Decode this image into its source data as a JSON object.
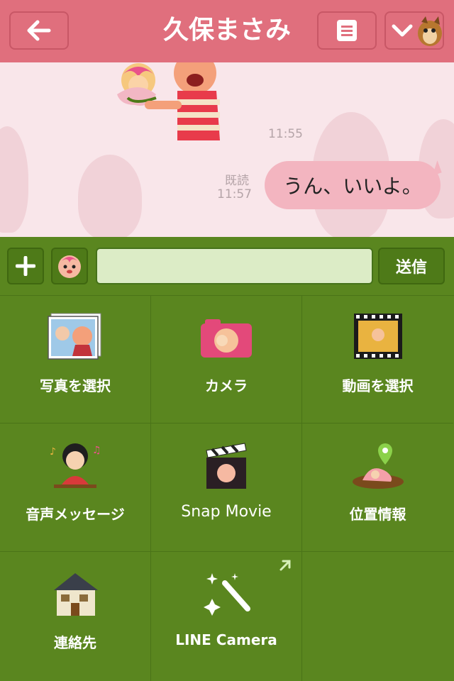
{
  "header": {
    "back_label": "←",
    "title": "久保まさみ",
    "menu_icon": "list-icon",
    "dropdown_icon": "chevron-down-icon",
    "bg_color": "#e06f7d"
  },
  "chat": {
    "sticker_time": "11:55",
    "read_label": "既読",
    "message_time": "11:57",
    "message_text": "うん、いいよ。",
    "bubble_color": "#f3b5c0"
  },
  "composer": {
    "plus_label": "+",
    "input_value": "",
    "input_placeholder": "",
    "send_label": "送信"
  },
  "attach_menu": {
    "items": [
      {
        "label": "写真を選択",
        "icon": "photo-select-icon"
      },
      {
        "label": "カメラ",
        "icon": "camera-icon"
      },
      {
        "label": "動画を選択",
        "icon": "video-select-icon"
      },
      {
        "label": "音声メッセージ",
        "icon": "voice-message-icon"
      },
      {
        "label": "Snap Movie",
        "icon": "snap-movie-icon"
      },
      {
        "label": "位置情報",
        "icon": "location-icon"
      },
      {
        "label": "連絡先",
        "icon": "contacts-icon"
      },
      {
        "label": "LINE Camera",
        "icon": "line-camera-icon"
      }
    ],
    "bg_color": "#5a861f"
  }
}
